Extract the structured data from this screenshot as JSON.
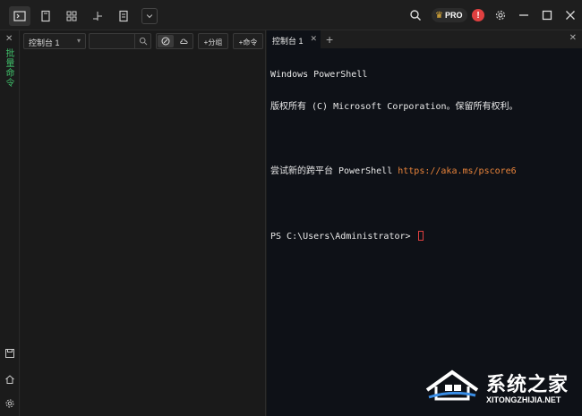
{
  "titlebar": {
    "pro_label": "PRO",
    "alert_label": "!"
  },
  "leftstrip": {
    "close": "✕",
    "label": "批量命令"
  },
  "toolbar": {
    "console_select": "控制台 1",
    "search_placeholder": "",
    "add_group": "+分组",
    "add_command": "+命令"
  },
  "terminal": {
    "tab_label": "控制台 1",
    "tab_close": "✕",
    "new_tab": "+",
    "panel_close": "✕",
    "lines": [
      "Windows PowerShell",
      "版权所有 (C) Microsoft Corporation。保留所有权利。",
      "",
      "尝试新的跨平台 PowerShell ",
      "",
      "PS C:\\Users\\Administrator> "
    ],
    "link": "https://aka.ms/pscore6"
  },
  "watermark": {
    "cn": "系统之家",
    "en": "XITONGZHIJIA.NET"
  },
  "colors": {
    "accent_green": "#3fbf6a",
    "link_orange": "#e8833a",
    "cursor_red": "#e04040",
    "terminal_bg": "#0e1117"
  }
}
